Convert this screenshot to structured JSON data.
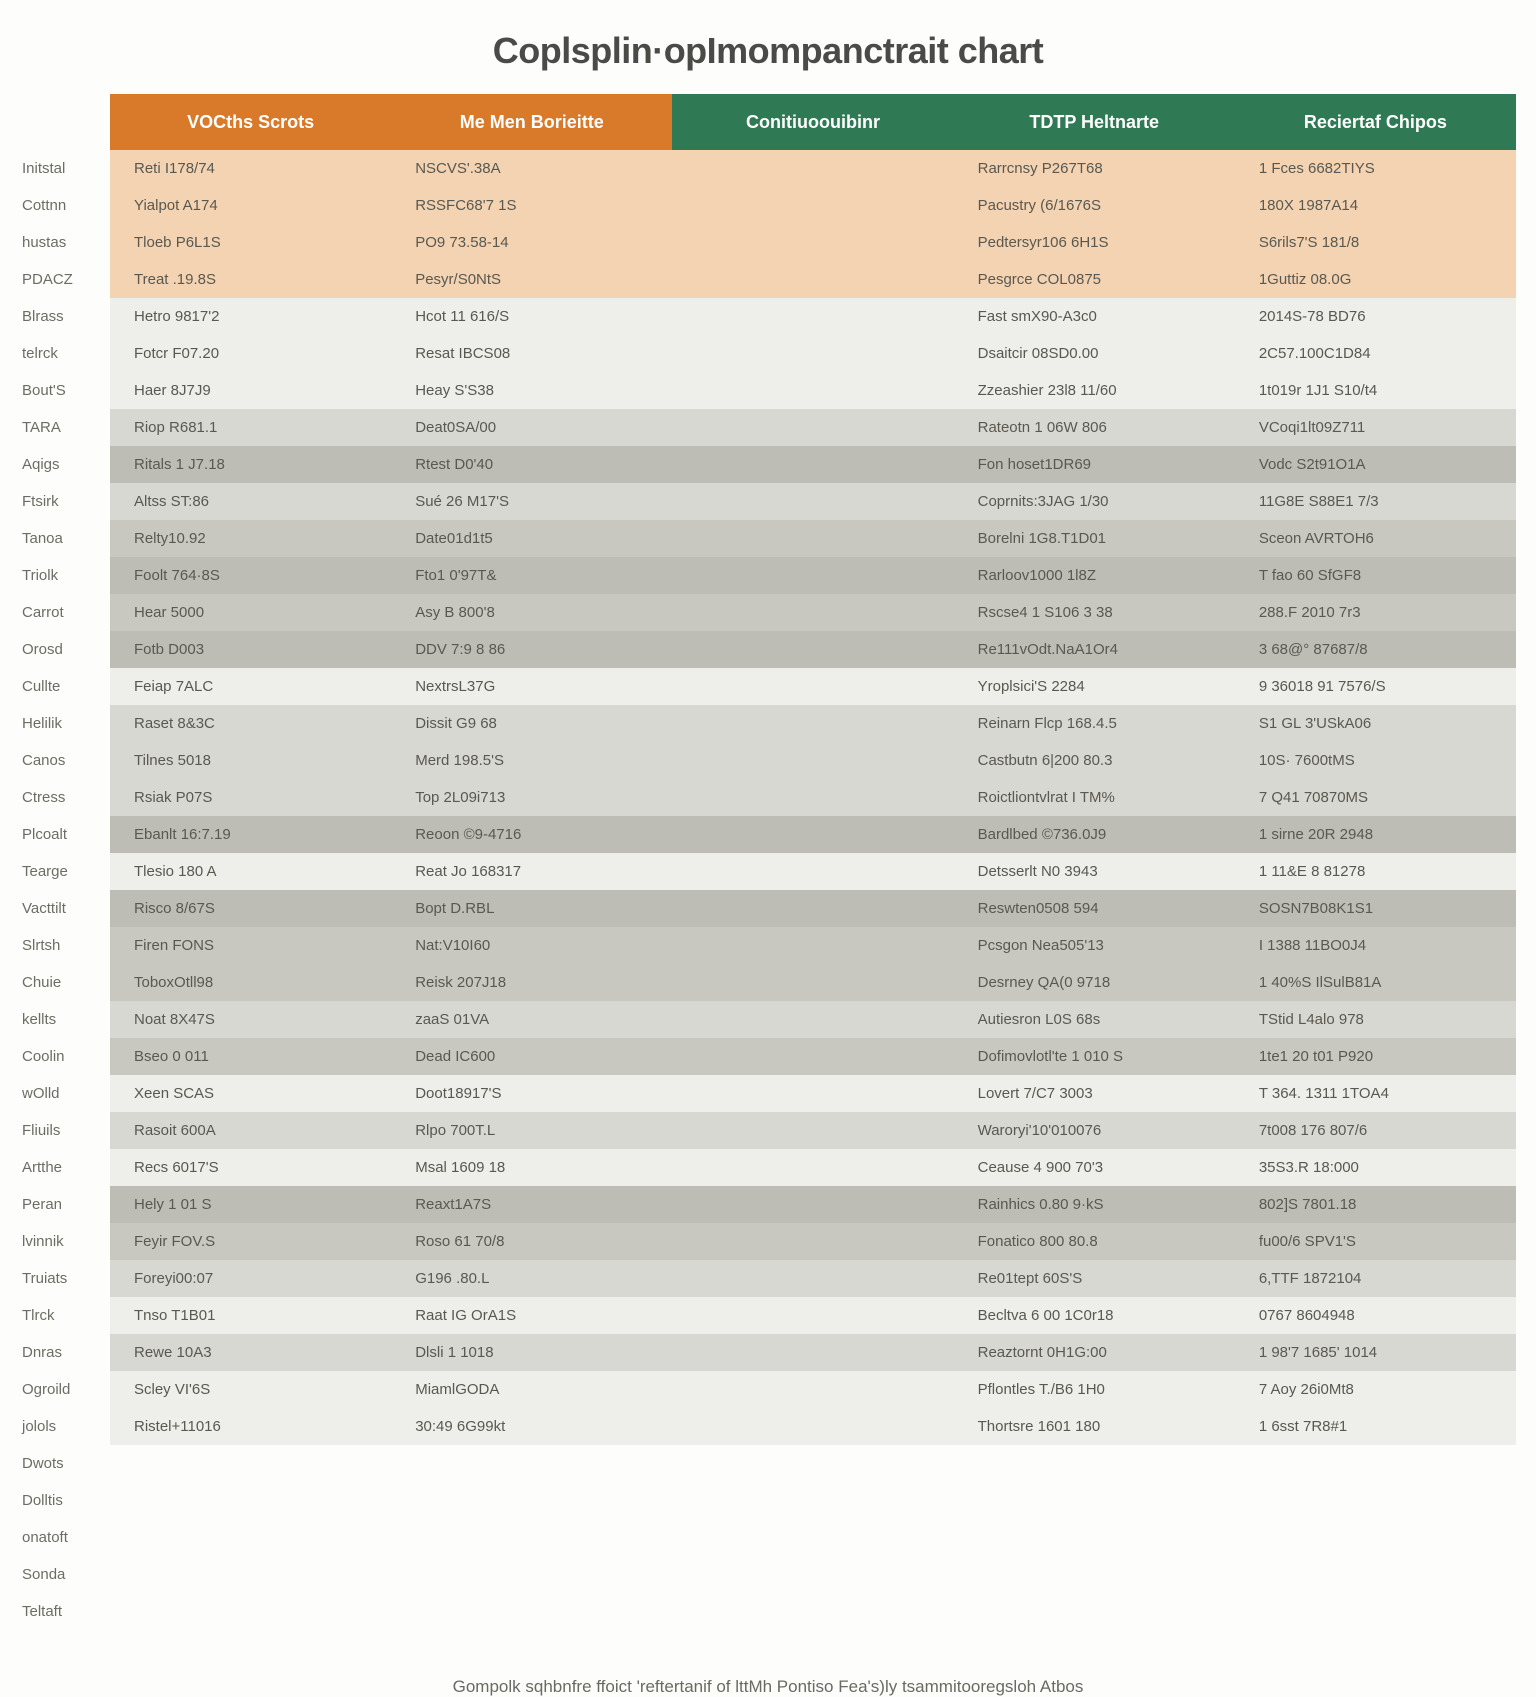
{
  "chart_data": {
    "type": "table",
    "title": "Coplsplin·opImompanctrait chart",
    "columns": [
      "VOCths Scrots",
      "Me Men Borieitte",
      "Conitiuoouibinr",
      "TDTP Heltnarte",
      "Reciertaf Chipos"
    ],
    "row_labels": [
      "Initstal",
      "Cottnn",
      "hustas",
      "PDACZ",
      "Blrass",
      "telrck",
      "Bout'S",
      "TARA",
      "Aqigs",
      "Ftsirk",
      "Tanoa",
      "Triolk",
      "Carrot",
      "Orosd",
      "Cullte",
      "Helilik",
      "Canos",
      "Ctress",
      "Plcoalt",
      "Tearge",
      "Vacttilt",
      "Slrtsh",
      "Chuie",
      "kellts",
      "Coolin",
      "wOlld",
      "Fliuils",
      "Artthe",
      "Peran",
      "lvinnik",
      "Truiats",
      "Tlrck",
      "Dnras",
      "Ogroild",
      "jolols",
      "Dwots",
      "Dolltis",
      "onatoft",
      "Sonda",
      "Teltaft",
      ""
    ],
    "bands": [
      "peach",
      "peach",
      "peach",
      "peach",
      "a",
      "a",
      "a",
      "b",
      "c",
      "b",
      "d",
      "c",
      "d",
      "c",
      "a",
      "b",
      "b",
      "b",
      "c",
      "a",
      "c",
      "d",
      "d",
      "b",
      "d",
      "a",
      "b",
      "a",
      "c",
      "d",
      "b",
      "a",
      "b",
      "a",
      "a",
      "b",
      "d",
      "a",
      "b",
      "f",
      "f"
    ],
    "rows": [
      [
        "Reti I178/74",
        "NSCVS'.38A",
        "",
        "Rarrcnsy P267T68",
        "1 Fces 6682TIYS"
      ],
      [
        "Yialpot A174",
        "RSSFC68'7 1S",
        "",
        "Pacustry (6/1676S",
        "180X 1987A14"
      ],
      [
        "Tloeb P6L1S",
        "PO9 73.58-14",
        "",
        "Pedtersyr106 6H1S",
        "S6rils7'S 181/8"
      ],
      [
        "Treat .19.8S",
        "Pesyr/S0NtS",
        "",
        "Pesgrce COL0875",
        "1Guttiz 08.0G"
      ],
      [
        "Hetro 9817'2",
        "Hcot 11 616/S",
        "",
        "Fast smX90-A3c0",
        "2014S-78 BD76"
      ],
      [
        "Fotcr F07.20",
        "Resat IBCS08",
        "",
        "Dsaitcir 08SD0.00",
        "2C57.100C1D84"
      ],
      [
        "Haer 8J7J9",
        "Heay S'S38",
        "",
        "Zzeashier 23l8 11/60",
        "1t019r 1J1 S10/t4"
      ],
      [
        "Riop R681.1",
        "Deat0SA/00",
        "",
        "Rateotn 1 06W 806",
        "VCoqi1lt09Z711"
      ],
      [
        "Ritals 1 J7.18",
        "Rtest D0'40",
        "",
        "Fon hoset1DR69",
        "Vodc S2t91O1A"
      ],
      [
        "Altss ST:86",
        "Sué 26 M17'S",
        "",
        "Coprnits:3JAG 1/30",
        "11G8E S88E1 7/3"
      ],
      [
        "Relty10.92",
        "Date01d1t5",
        "",
        "Borelni 1G8.T1D01",
        "Sceon AVRTOH6"
      ],
      [
        "Foolt 764·8S",
        "Fto1 0'97T&",
        "",
        "Rarloov1000 1l8Z",
        "T fao 60 SfGF8"
      ],
      [
        "Hear 5000",
        "Asy B 800'8",
        "",
        "Rscse4 1 S106 3 38",
        "288.F 2010 7r3"
      ],
      [
        "Fotb D003",
        "DDV 7:9 8 86",
        "",
        "Re111vOdt.NaA1Or4",
        "3 68@° 87687/8"
      ],
      [
        "Feiap 7ALC",
        "NextrsL37G",
        "",
        "Yroplsici'S 2284",
        "9 36018 91 7576/S"
      ],
      [
        "Raset 8&3C",
        "Dissit G9 68",
        "",
        "Reinarn Flcp 168.4.5",
        "S1 GL 3'USkA06"
      ],
      [
        "Tilnes 5018",
        "Merd 198.5'S",
        "",
        "Castbutn 6|200 80.3",
        "10S· 7600tMS"
      ],
      [
        "Rsiak P07S",
        "Top 2L09i713",
        "",
        "Roictliontvlrat I TM%",
        "7 Q41 70870MS"
      ],
      [
        "Ebanlt 16:7.19",
        "Reoon ©9-4716",
        "",
        "Bardlbed ©736.0J9",
        "1 sirne 20R 2948"
      ],
      [
        "Tlesio 180 A",
        "Reat Jo 168317",
        "",
        "Detsserlt N0 3943",
        "1 11&E 8 81278"
      ],
      [
        "Risco 8/67S",
        "Bopt D.RBL",
        "",
        "Reswten0508 594",
        "SOSN7B08K1S1"
      ],
      [
        "Firen FONS",
        "Nat:V10I60",
        "",
        "Pcsgon Nea505'13",
        "I 1388 11BO0J4"
      ],
      [
        "ToboxOtll98",
        "Reisk 207J18",
        "",
        "Desrney QA(0 9718",
        "1 40%S IlSulB81A"
      ],
      [
        "Noat 8X47S",
        "zaaS 01VA",
        "",
        "Autiesron L0S 68s",
        "TStid L4alo 978"
      ],
      [
        "Bseo 0 011",
        "Dead IC600",
        "",
        "Dofimovlotl'te 1 010 S",
        "1te1 20 t01 P920"
      ],
      [
        "Xeen SCAS",
        "Doot18917'S",
        "",
        "Lovert 7/C7 3003",
        "T 364. 1311 1TOA4"
      ],
      [
        "Rasoit 600A",
        "Rlpo 700T.L",
        "",
        "Waroryi'10'010076",
        "7t008 176 807/6"
      ],
      [
        "Recs 6017'S",
        "Msal 1609 18",
        "",
        "Ceause 4 900 70'3",
        "35S3.R 18:000"
      ],
      [
        "Hely 1 01 S",
        "Reaxt1A7S",
        "",
        "Rainhics 0.80 9·kS",
        "802]S 7801.18"
      ],
      [
        "Feyir FOV.S",
        "Roso 61 70/8",
        "",
        "Fonatico 800 80.8",
        "fu00/6 SPV1'S"
      ],
      [
        "Foreyi00:07",
        "G196 .80.L",
        "",
        "Re01tept 60S'S",
        "6,TTF 1872104"
      ],
      [
        "Tnso T1B01",
        "Raat IG OrA1S",
        "",
        "Becltva 6 00 1C0r18",
        "0767 8604948"
      ],
      [
        "Rewe 10A3",
        "Dlsli 1 1018",
        "",
        "Reaztornt 0H1G:00",
        "1 98'7 1685' 1014"
      ],
      [
        "Scley VI'6S",
        "MiamlGODA",
        "",
        "Pflontles T./B6 1H0",
        "7 Aoy 26i0Mt8"
      ],
      [
        "Ristel+11016",
        "30:49 6G99kt",
        "",
        "Thortsre 1601 180",
        "1 6sst 7R8#1"
      ],
      [
        "",
        "",
        "",
        "",
        ""
      ],
      [
        "",
        "",
        "",
        "",
        ""
      ],
      [
        "",
        "",
        "",
        "",
        ""
      ],
      [
        "",
        "",
        "",
        "",
        ""
      ],
      [
        "",
        "",
        "",
        "",
        ""
      ],
      [
        "",
        "",
        "",
        "",
        ""
      ]
    ],
    "footer": "Gompolk sqhbnfre ffoict 'reftertanif of lttMh Pontiso Fea's)ly tsammitooregsloh Atbos"
  }
}
